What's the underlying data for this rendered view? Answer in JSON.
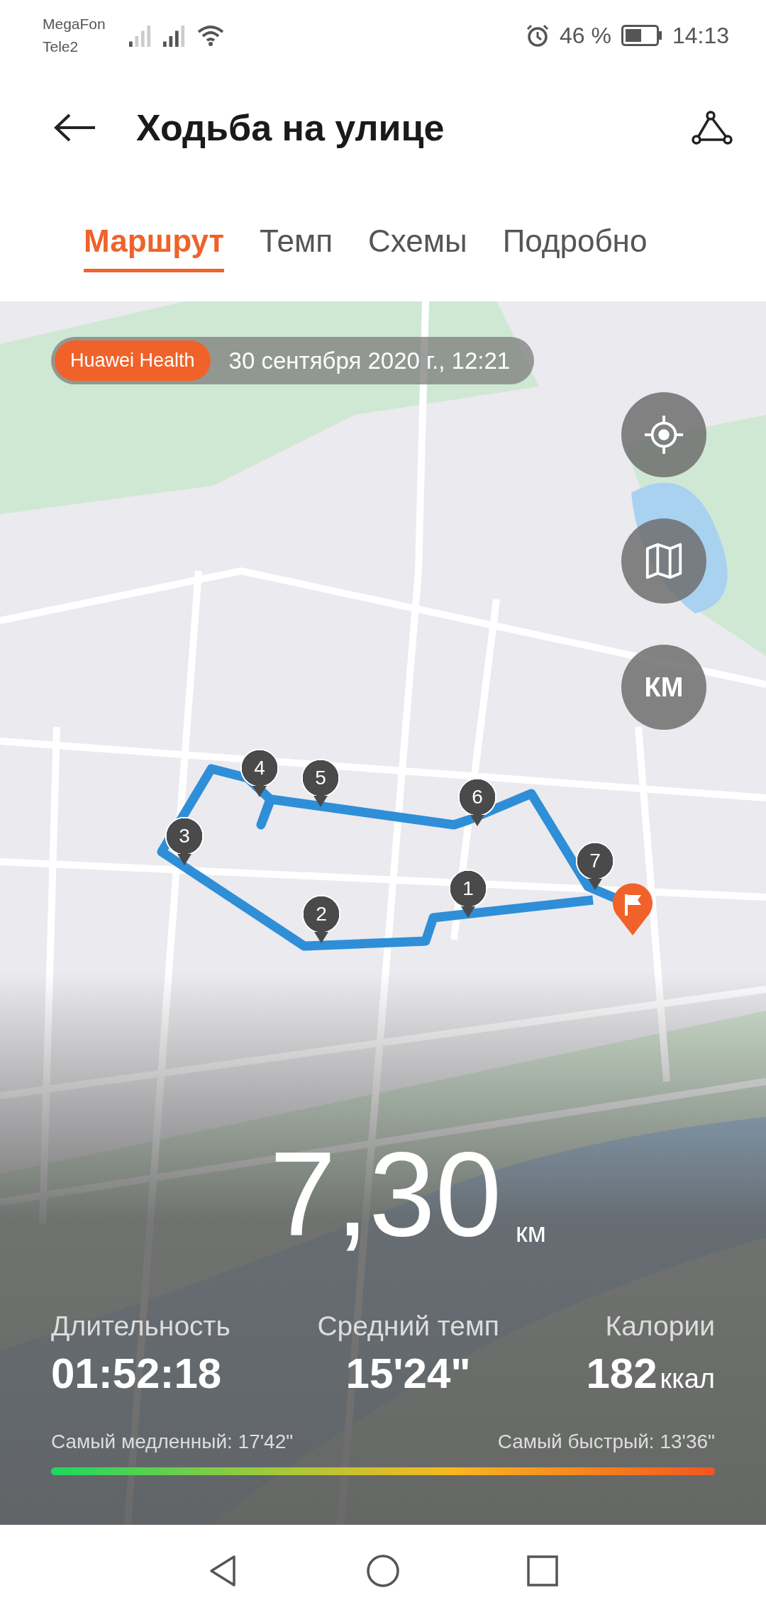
{
  "status_bar": {
    "carrier_1": "MegaFon",
    "carrier_2": "Tele2",
    "battery_text": "46 %",
    "time": "14:13"
  },
  "header": {
    "title": "Ходьба на улице"
  },
  "tabs": [
    {
      "label": "Маршрут",
      "selected": true
    },
    {
      "label": "Темп",
      "selected": false
    },
    {
      "label": "Схемы",
      "selected": false
    },
    {
      "label": "Подробно",
      "selected": false
    }
  ],
  "map": {
    "source_badge": "Huawei Health",
    "date": "30 сентября 2020 г., 12:21",
    "unit_button": "КМ",
    "markers": [
      "1",
      "2",
      "3",
      "4",
      "5",
      "6",
      "7"
    ]
  },
  "summary": {
    "distance": "7,30",
    "distance_unit": "км",
    "stats": [
      {
        "label": "Длительность",
        "value": "01:52:18"
      },
      {
        "label": "Средний темп",
        "value": "15'24\""
      },
      {
        "label": "Калории",
        "value": "182",
        "unit": "ккал"
      }
    ],
    "slowest": "Самый медленный: 17'42\"",
    "fastest": "Самый быстрый: 13'36\""
  }
}
